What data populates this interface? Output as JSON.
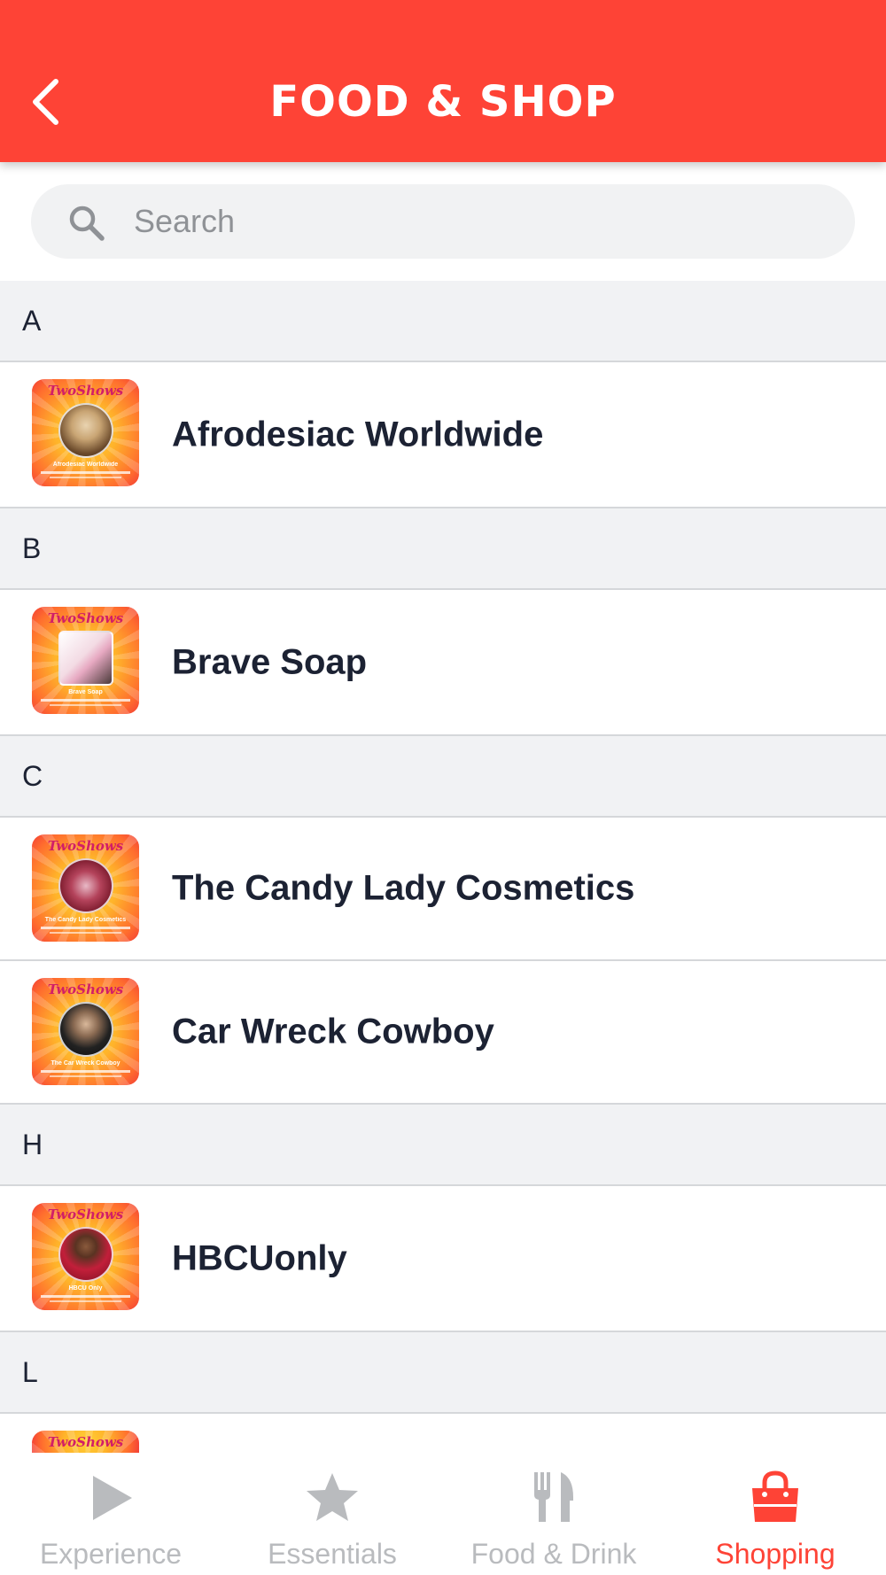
{
  "header": {
    "title": "FOOD & SHOP",
    "back_icon": "chevron-left-icon"
  },
  "search": {
    "placeholder": "Search",
    "value": "",
    "icon": "search-icon"
  },
  "sections": [
    {
      "letter": "A",
      "items": [
        {
          "name": "Afrodesiac Worldwide",
          "thumb_caption": "Afrodesiac Worldwide"
        }
      ]
    },
    {
      "letter": "B",
      "items": [
        {
          "name": "Brave Soap",
          "thumb_caption": "Brave Soap"
        }
      ]
    },
    {
      "letter": "C",
      "items": [
        {
          "name": "The Candy Lady Cosmetics",
          "thumb_caption": "The Candy Lady Cosmetics"
        },
        {
          "name": "Car Wreck Cowboy",
          "thumb_caption": "The Car Wreck Cowboy"
        }
      ]
    },
    {
      "letter": "H",
      "items": [
        {
          "name": "HBCUonly",
          "thumb_caption": "HBCU Only"
        }
      ]
    },
    {
      "letter": "L",
      "items": []
    }
  ],
  "thumb_brand": "TwoShows",
  "tabs": [
    {
      "label": "Experience",
      "icon": "play-icon",
      "active": false
    },
    {
      "label": "Essentials",
      "icon": "star-icon",
      "active": false
    },
    {
      "label": "Food & Drink",
      "icon": "fork-knife-icon",
      "active": false
    },
    {
      "label": "Shopping",
      "icon": "shopping-bag-icon",
      "active": true
    }
  ],
  "colors": {
    "brand_red": "#fe4336",
    "section_bg": "#f1f2f4",
    "inactive_tab": "#b9bbbe",
    "text_dark": "#1c2233"
  }
}
